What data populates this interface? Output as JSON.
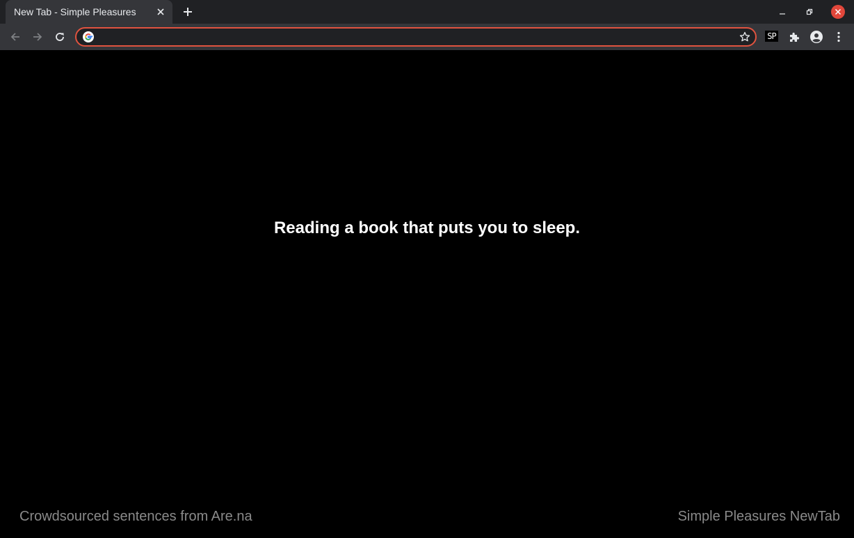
{
  "browser": {
    "tab": {
      "title": "New Tab - Simple Pleasures"
    },
    "omnibox": {
      "value": "",
      "placeholder": ""
    },
    "extension_badge": "SP",
    "accent_color": "#e0533f",
    "icons": [
      "close-icon",
      "plus-icon",
      "minimize-icon",
      "restore-icon",
      "window-close-icon",
      "back-arrow-icon",
      "forward-arrow-icon",
      "reload-icon",
      "google-icon",
      "star-icon",
      "puzzle-icon",
      "account-icon",
      "more-vert-icon"
    ]
  },
  "page": {
    "sentence": "Reading a book that puts you to sleep.",
    "footer_left": "Crowdsourced sentences from Are.na",
    "footer_right": "Simple Pleasures NewTab"
  }
}
